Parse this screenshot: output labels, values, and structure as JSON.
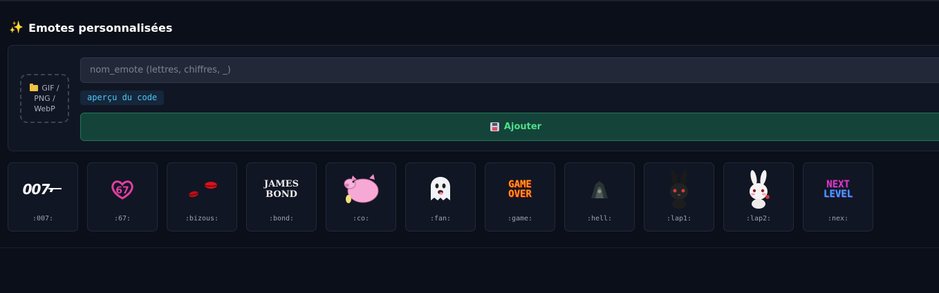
{
  "section": {
    "title": "Emotes personnalisées",
    "title_icon": "sparkles-icon"
  },
  "form": {
    "dropzone": {
      "icon": "folder-icon",
      "line1": "GIF /",
      "line2": "PNG /",
      "line3": "WebP"
    },
    "name_input": {
      "placeholder": "nom_emote (lettres, chiffres, _)",
      "value": ""
    },
    "code_preview": "aperçu du code",
    "add_button": {
      "icon": "floppy-disk-icon",
      "label": "Ajouter"
    }
  },
  "emotes": [
    {
      "code": ":007:",
      "art_text": "007",
      "icon": "007-logo-icon"
    },
    {
      "code": ":67:",
      "art_text": "67",
      "icon": "pink-67-heart-icon"
    },
    {
      "code": ":bizous:",
      "icon": "kiss-lips-icon"
    },
    {
      "code": ":bond:",
      "art_text_1": "JAMES",
      "art_text_2": "BOND",
      "icon": "james-bond-logo-icon"
    },
    {
      "code": ":co:",
      "icon": "pink-pig-icon"
    },
    {
      "code": ":fan:",
      "icon": "ghost-icon"
    },
    {
      "code": ":game:",
      "art_text_1": "GAME",
      "art_text_2": "OVER",
      "icon": "game-over-icon"
    },
    {
      "code": ":hell:",
      "icon": "hooded-figure-icon"
    },
    {
      "code": ":lap1:",
      "icon": "black-bunny-icon"
    },
    {
      "code": ":lap2:",
      "icon": "white-bunny-icon"
    },
    {
      "code": ":nex:",
      "art_text_1": "NEXT",
      "art_text_2": "LEVEL",
      "icon": "next-level-icon"
    }
  ],
  "colors": {
    "background": "#0b0f19",
    "card": "#111624",
    "accent_green": "#4ee08a",
    "accent_code": "#4fc3f7"
  }
}
